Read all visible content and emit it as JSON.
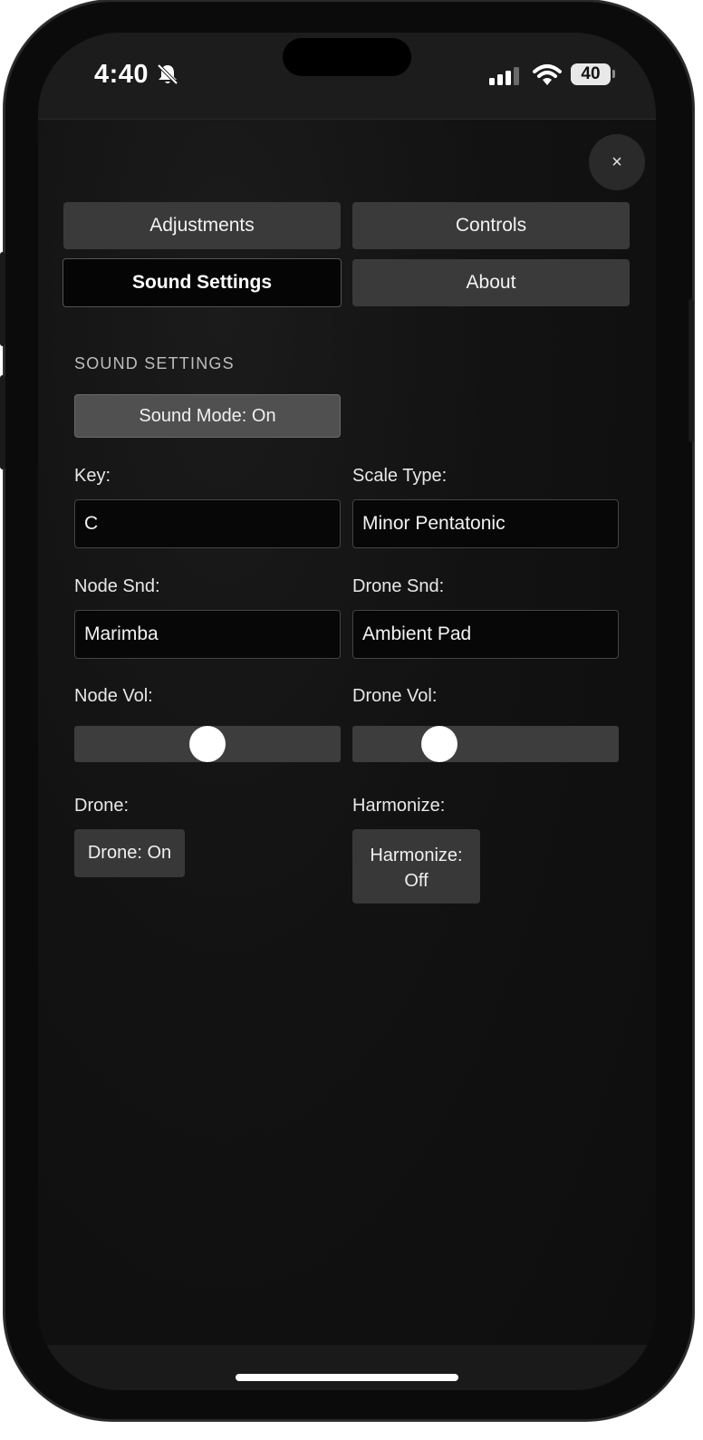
{
  "status_bar": {
    "time": "4:40",
    "battery_level": "40",
    "icons": [
      "bell-slash-icon",
      "signal-icon",
      "wifi-icon",
      "battery-icon"
    ]
  },
  "close_label": "×",
  "tabs": [
    {
      "label": "Adjustments",
      "active": false
    },
    {
      "label": "Controls",
      "active": false
    },
    {
      "label": "Sound Settings",
      "active": true
    },
    {
      "label": "About",
      "active": false
    }
  ],
  "section_title": "SOUND SETTINGS",
  "sound_mode": {
    "label": "Sound Mode: On"
  },
  "key": {
    "label": "Key:",
    "value": "C"
  },
  "scale_type": {
    "label": "Scale Type:",
    "value": "Minor Pentatonic"
  },
  "node_sound": {
    "label": "Node Snd:",
    "value": "Marimba"
  },
  "drone_sound": {
    "label": "Drone Snd:",
    "value": "Ambient Pad"
  },
  "node_volume": {
    "label": "Node Vol:",
    "level": 0.5
  },
  "drone_volume": {
    "label": "Drone Vol:",
    "level": 0.3
  },
  "drone": {
    "label": "Drone:",
    "button": "Drone: On"
  },
  "harmonize": {
    "label": "Harmonize:",
    "button_line1": "Harmonize:",
    "button_line2": "Off"
  },
  "colors": {
    "accent": "#3a3a3a",
    "active_tab": "#050505",
    "background": "#121212"
  }
}
